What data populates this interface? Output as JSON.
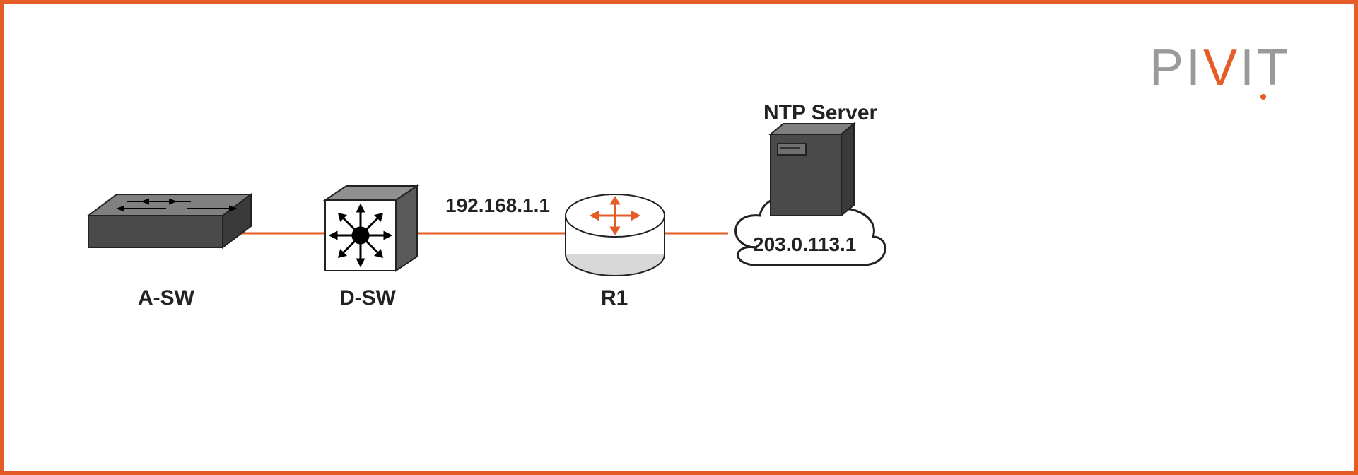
{
  "brand": {
    "name": "PIVIT"
  },
  "diagram": {
    "devices": {
      "a_sw": {
        "label": "A-SW"
      },
      "d_sw": {
        "label": "D-SW"
      },
      "r1": {
        "label": "R1",
        "interface_ip": "192.168.1.1"
      },
      "ntp": {
        "label": "NTP Server",
        "ip": "203.0.113.1"
      }
    },
    "links": [
      {
        "from": "a_sw",
        "to": "d_sw"
      },
      {
        "from": "d_sw",
        "to": "r1"
      },
      {
        "from": "r1",
        "to": "ntp"
      }
    ]
  }
}
